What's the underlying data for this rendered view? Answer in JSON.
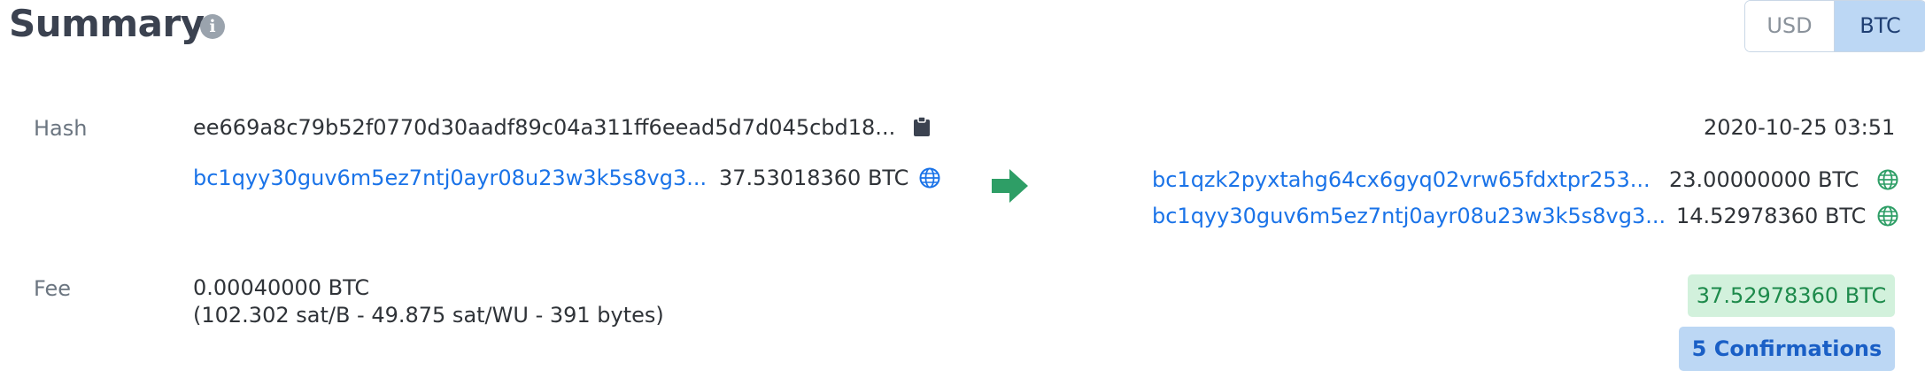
{
  "header": {
    "title": "Summary",
    "info_icon_glyph": "i",
    "currency_toggle": {
      "options": [
        "USD",
        "BTC"
      ],
      "selected": "BTC"
    }
  },
  "hash": {
    "label": "Hash",
    "value": "ee669a8c79b52f0770d30aadf89c04a311ff6eead5d7d045cbd18...",
    "timestamp": "2020-10-25 03:51"
  },
  "inputs": [
    {
      "address": "bc1qyy30guv6m5ez7ntj0ayr08u23w3k5s8vg3...",
      "amount": "37.53018360 BTC"
    }
  ],
  "outputs": [
    {
      "address": "bc1qzk2pyxtahg64cx6gyq02vrw65fdxtpr253...",
      "amount": "23.00000000 BTC"
    },
    {
      "address": "bc1qyy30guv6m5ez7ntj0ayr08u23w3k5s8vg3...",
      "amount": "14.52978360 BTC"
    }
  ],
  "fee": {
    "label": "Fee",
    "amount": "0.00040000 BTC",
    "details": "(102.302 sat/B - 49.875 sat/WU - 391 bytes)",
    "total_output": "37.52978360 BTC",
    "confirmations": "5 Confirmations"
  },
  "colors": {
    "link": "#1a73e8",
    "arrow": "#2e9e66",
    "confirmed_green": "#1d8a4b",
    "accent_blue": "#bcd7f4"
  },
  "icons": {
    "info": "info-icon",
    "copy": "clipboard-icon",
    "input_globe": "globe-icon",
    "output_globe": "globe-icon",
    "arrow": "arrow-right-icon"
  }
}
